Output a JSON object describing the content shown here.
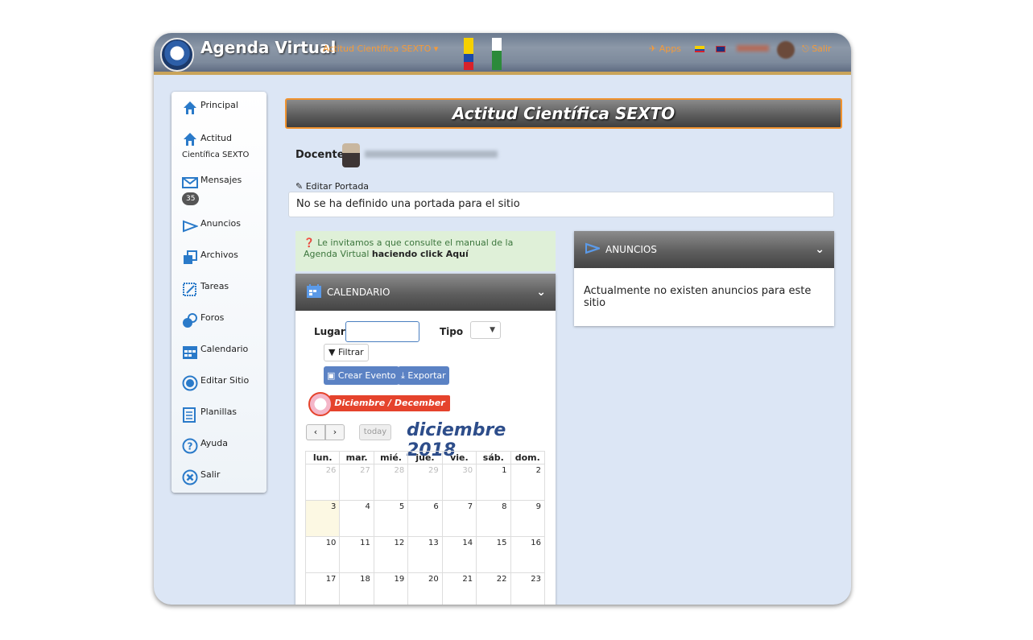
{
  "header": {
    "brand": "Agenda Virtual",
    "course_menu": "Actitud Científica SEXTO ▾",
    "apps": "Apps",
    "salir": "Salir"
  },
  "sidebar": {
    "items": [
      {
        "label": "Principal",
        "icon": "home-icon"
      },
      {
        "label": "Actitud",
        "label2": "Científica SEXTO",
        "icon": "home-icon"
      },
      {
        "label": "Mensajes",
        "badge": "35",
        "icon": "envelope-icon"
      },
      {
        "label": "Anuncios",
        "icon": "megaphone-icon"
      },
      {
        "label": "Archivos",
        "icon": "files-icon"
      },
      {
        "label": "Tareas",
        "icon": "tasks-icon"
      },
      {
        "label": "Foros",
        "icon": "forum-icon"
      },
      {
        "label": "Calendario",
        "icon": "calendar-icon"
      },
      {
        "label": "Editar Sitio",
        "icon": "edit-site-icon"
      },
      {
        "label": "Planillas",
        "icon": "sheets-icon"
      },
      {
        "label": "Ayuda",
        "icon": "help-icon"
      },
      {
        "label": "Salir",
        "icon": "exit-icon"
      }
    ]
  },
  "main": {
    "title": "Actitud Científica SEXTO",
    "docente_label": "Docente",
    "edit_portada": "Editar Portada",
    "portada_text": "No se ha definido una portada para el sitio",
    "manual_prefix": "Le invitamos a que consulte el manual de la Agenda Virtual",
    "manual_link": "haciendo click Aquí"
  },
  "calendar_panel": {
    "title": "CALENDARIO",
    "lugar_label": "Lugar",
    "lugar_value": "",
    "tipo_label": "Tipo",
    "filtrar": "Filtrar",
    "crear_evento": "Crear Evento",
    "exportar": "Exportar",
    "month_ribbon": "Diciembre / December",
    "today": "today",
    "month_title": "diciembre 2018",
    "weekdays": [
      "lun.",
      "mar.",
      "mié.",
      "jue.",
      "vie.",
      "sáb.",
      "dom."
    ],
    "weeks": [
      [
        "26",
        "27",
        "28",
        "29",
        "30",
        "1",
        "2"
      ],
      [
        "3",
        "4",
        "5",
        "6",
        "7",
        "8",
        "9"
      ],
      [
        "10",
        "11",
        "12",
        "13",
        "14",
        "15",
        "16"
      ],
      [
        "17",
        "18",
        "19",
        "20",
        "21",
        "22",
        "23"
      ]
    ]
  },
  "anuncios_panel": {
    "title": "ANUNCIOS",
    "text": "Actualmente no existen anuncios para este sitio"
  },
  "colors": {
    "accent_orange": "#f0922e",
    "panel_blue": "#dce6f5",
    "button_blue": "#5b82c4"
  }
}
